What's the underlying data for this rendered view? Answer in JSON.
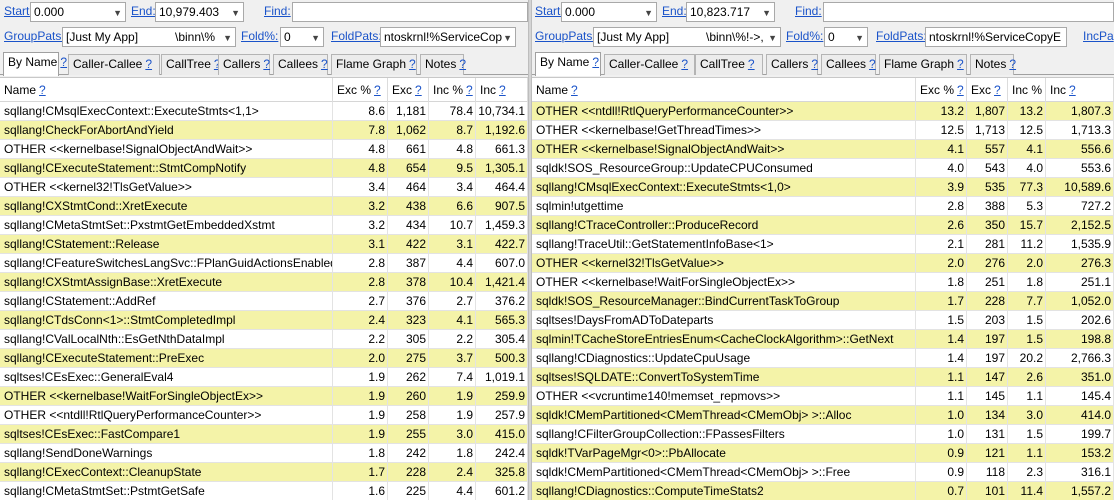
{
  "left": {
    "start_label": "Start:",
    "start_value": "0.000",
    "end_label": "End:",
    "end_value": "10,979.403",
    "find_label": "Find:",
    "find_value": "",
    "grouppats_label": "GroupPats:",
    "grouppats_value": "[Just My App]",
    "grouppats_extra": "\\binn\\%",
    "fold_label": "Fold%:",
    "fold_value": "0",
    "foldpats_label": "FoldPats:",
    "foldpats_value": "ntoskrnl!%ServiceCop",
    "tabs": [
      {
        "label": "By Name",
        "q": "?"
      },
      {
        "label": "Caller-Callee",
        "q": "?"
      },
      {
        "label": "CallTree",
        "q": "?"
      },
      {
        "label": "Callers",
        "q": "?"
      },
      {
        "label": "Callees",
        "q": "?"
      },
      {
        "label": "Flame Graph",
        "q": "?"
      },
      {
        "label": "Notes",
        "q": "?"
      }
    ],
    "columns": [
      {
        "label": "Name",
        "q": "?"
      },
      {
        "label": "Exc %",
        "q": "?"
      },
      {
        "label": "Exc",
        "q": "?"
      },
      {
        "label": "Inc %",
        "q": "?"
      },
      {
        "label": "Inc",
        "q": "?"
      }
    ],
    "rows": [
      {
        "name": "sqllang!CMsqlExecContext::ExecuteStmts<1,1>",
        "excp": "8.6",
        "exc": "1,181",
        "incp": "78.4",
        "inc": "10,734.1",
        "hl": false
      },
      {
        "name": "sqllang!CheckForAbortAndYield",
        "excp": "7.8",
        "exc": "1,062",
        "incp": "8.7",
        "inc": "1,192.6",
        "hl": true
      },
      {
        "name": "OTHER <<kernelbase!SignalObjectAndWait>>",
        "excp": "4.8",
        "exc": "661",
        "incp": "4.8",
        "inc": "661.3",
        "hl": false
      },
      {
        "name": "sqllang!CExecuteStatement::StmtCompNotify",
        "excp": "4.8",
        "exc": "654",
        "incp": "9.5",
        "inc": "1,305.1",
        "hl": true
      },
      {
        "name": "OTHER <<kernel32!TlsGetValue>>",
        "excp": "3.4",
        "exc": "464",
        "incp": "3.4",
        "inc": "464.4",
        "hl": false
      },
      {
        "name": "sqllang!CXStmtCond::XretExecute",
        "excp": "3.2",
        "exc": "438",
        "incp": "6.6",
        "inc": "907.5",
        "hl": true
      },
      {
        "name": "sqllang!CMetaStmtSet::PxstmtGetEmbeddedXstmt",
        "excp": "3.2",
        "exc": "434",
        "incp": "10.7",
        "inc": "1,459.3",
        "hl": false
      },
      {
        "name": "sqllang!CStatement::Release",
        "excp": "3.1",
        "exc": "422",
        "incp": "3.1",
        "inc": "422.7",
        "hl": true
      },
      {
        "name": "sqllang!CFeatureSwitchesLangSvc::FPlanGuidActionsEnabled",
        "excp": "2.8",
        "exc": "387",
        "incp": "4.4",
        "inc": "607.0",
        "hl": false
      },
      {
        "name": "sqllang!CXStmtAssignBase::XretExecute",
        "excp": "2.8",
        "exc": "378",
        "incp": "10.4",
        "inc": "1,421.4",
        "hl": true
      },
      {
        "name": "sqllang!CStatement::AddRef",
        "excp": "2.7",
        "exc": "376",
        "incp": "2.7",
        "inc": "376.2",
        "hl": false
      },
      {
        "name": "sqllang!CTdsConn<1>::StmtCompletedImpl",
        "excp": "2.4",
        "exc": "323",
        "incp": "4.1",
        "inc": "565.3",
        "hl": true
      },
      {
        "name": "sqllang!CValLocalNth::EsGetNthDataImpl",
        "excp": "2.2",
        "exc": "305",
        "incp": "2.2",
        "inc": "305.4",
        "hl": false
      },
      {
        "name": "sqllang!CExecuteStatement::PreExec",
        "excp": "2.0",
        "exc": "275",
        "incp": "3.7",
        "inc": "500.3",
        "hl": true
      },
      {
        "name": "sqltses!CEsExec::GeneralEval4",
        "excp": "1.9",
        "exc": "262",
        "incp": "7.4",
        "inc": "1,019.1",
        "hl": false
      },
      {
        "name": "OTHER <<kernelbase!WaitForSingleObjectEx>>",
        "excp": "1.9",
        "exc": "260",
        "incp": "1.9",
        "inc": "259.9",
        "hl": true
      },
      {
        "name": "OTHER <<ntdll!RtlQueryPerformanceCounter>>",
        "excp": "1.9",
        "exc": "258",
        "incp": "1.9",
        "inc": "257.9",
        "hl": false
      },
      {
        "name": "sqltses!CEsExec::FastCompare1",
        "excp": "1.9",
        "exc": "255",
        "incp": "3.0",
        "inc": "415.0",
        "hl": true
      },
      {
        "name": "sqllang!SendDoneWarnings",
        "excp": "1.8",
        "exc": "242",
        "incp": "1.8",
        "inc": "242.4",
        "hl": false
      },
      {
        "name": "sqllang!CExecContext::CleanupState",
        "excp": "1.7",
        "exc": "228",
        "incp": "2.4",
        "inc": "325.8",
        "hl": true
      },
      {
        "name": "sqllang!CMetaStmtSet::PstmtGetSafe",
        "excp": "1.6",
        "exc": "225",
        "incp": "4.4",
        "inc": "601.2",
        "hl": false
      }
    ]
  },
  "right": {
    "start_label": "Start:",
    "start_value": "0.000",
    "end_label": "End:",
    "end_value": "10,823.717",
    "find_label": "Find:",
    "find_value": "",
    "grouppats_label": "GroupPats:",
    "grouppats_value": "[Just My App]",
    "grouppats_extra": "\\binn\\%!->,",
    "fold_label": "Fold%:",
    "fold_value": "0",
    "foldpats_label": "FoldPats:",
    "foldpats_value": "ntoskrnl!%ServiceCopyE",
    "incpats_label": "IncPa",
    "tabs": [
      {
        "label": "By Name",
        "q": "?"
      },
      {
        "label": "Caller-Callee",
        "q": "?"
      },
      {
        "label": "CallTree",
        "q": "?"
      },
      {
        "label": "Callers",
        "q": "?"
      },
      {
        "label": "Callees",
        "q": "?"
      },
      {
        "label": "Flame Graph",
        "q": "?"
      },
      {
        "label": "Notes",
        "q": "?"
      }
    ],
    "columns": [
      {
        "label": "Name",
        "q": "?"
      },
      {
        "label": "Exc %",
        "q": "?"
      },
      {
        "label": "Exc",
        "q": "?"
      },
      {
        "label": "Inc %",
        "q": "?"
      },
      {
        "label": "Inc",
        "q": "?"
      }
    ],
    "rows": [
      {
        "name": "OTHER <<ntdll!RtlQueryPerformanceCounter>>",
        "excp": "13.2",
        "exc": "1,807",
        "incp": "13.2",
        "inc": "1,807.3",
        "hl": true
      },
      {
        "name": "OTHER <<kernelbase!GetThreadTimes>>",
        "excp": "12.5",
        "exc": "1,713",
        "incp": "12.5",
        "inc": "1,713.3",
        "hl": false
      },
      {
        "name": "OTHER <<kernelbase!SignalObjectAndWait>>",
        "excp": "4.1",
        "exc": "557",
        "incp": "4.1",
        "inc": "556.6",
        "hl": true
      },
      {
        "name": "sqldk!SOS_ResourceGroup::UpdateCPUConsumed",
        "excp": "4.0",
        "exc": "543",
        "incp": "4.0",
        "inc": "553.6",
        "hl": false
      },
      {
        "name": "sqllang!CMsqlExecContext::ExecuteStmts<1,0>",
        "excp": "3.9",
        "exc": "535",
        "incp": "77.3",
        "inc": "10,589.6",
        "hl": true
      },
      {
        "name": "sqlmin!utgettime",
        "excp": "2.8",
        "exc": "388",
        "incp": "5.3",
        "inc": "727.2",
        "hl": false
      },
      {
        "name": "sqllang!CTraceController::ProduceRecord",
        "excp": "2.6",
        "exc": "350",
        "incp": "15.7",
        "inc": "2,152.5",
        "hl": true
      },
      {
        "name": "sqllang!TraceUtil::GetStatementInfoBase<1>",
        "excp": "2.1",
        "exc": "281",
        "incp": "11.2",
        "inc": "1,535.9",
        "hl": false
      },
      {
        "name": "OTHER <<kernel32!TlsGetValue>>",
        "excp": "2.0",
        "exc": "276",
        "incp": "2.0",
        "inc": "276.3",
        "hl": true
      },
      {
        "name": "OTHER <<kernelbase!WaitForSingleObjectEx>>",
        "excp": "1.8",
        "exc": "251",
        "incp": "1.8",
        "inc": "251.1",
        "hl": false
      },
      {
        "name": "sqldk!SOS_ResourceManager::BindCurrentTaskToGroup",
        "excp": "1.7",
        "exc": "228",
        "incp": "7.7",
        "inc": "1,052.0",
        "hl": true
      },
      {
        "name": "sqltses!DaysFromADToDateparts",
        "excp": "1.5",
        "exc": "203",
        "incp": "1.5",
        "inc": "202.6",
        "hl": false
      },
      {
        "name": "sqlmin!TCacheStoreEntriesEnum<CacheClockAlgorithm>::GetNext",
        "excp": "1.4",
        "exc": "197",
        "incp": "1.5",
        "inc": "198.8",
        "hl": true
      },
      {
        "name": "sqllang!CDiagnostics::UpdateCpuUsage",
        "excp": "1.4",
        "exc": "197",
        "incp": "20.2",
        "inc": "2,766.3",
        "hl": false
      },
      {
        "name": "sqltses!SQLDATE::ConvertToSystemTime",
        "excp": "1.1",
        "exc": "147",
        "incp": "2.6",
        "inc": "351.0",
        "hl": true
      },
      {
        "name": "OTHER <<vcruntime140!memset_repmovs>>",
        "excp": "1.1",
        "exc": "145",
        "incp": "1.1",
        "inc": "145.4",
        "hl": false
      },
      {
        "name": "sqldk!CMemPartitioned<CMemThread<CMemObj> >::Alloc",
        "excp": "1.0",
        "exc": "134",
        "incp": "3.0",
        "inc": "414.0",
        "hl": true
      },
      {
        "name": "sqllang!CFilterGroupCollection::FPassesFilters",
        "excp": "1.0",
        "exc": "131",
        "incp": "1.5",
        "inc": "199.7",
        "hl": false
      },
      {
        "name": "sqldk!TVarPageMgr<0>::PbAllocate",
        "excp": "0.9",
        "exc": "121",
        "incp": "1.1",
        "inc": "153.2",
        "hl": true
      },
      {
        "name": "sqldk!CMemPartitioned<CMemThread<CMemObj> >::Free",
        "excp": "0.9",
        "exc": "118",
        "incp": "2.3",
        "inc": "316.1",
        "hl": false
      },
      {
        "name": "sqllang!CDiagnostics::ComputeTimeStats2",
        "excp": "0.7",
        "exc": "101",
        "incp": "11.4",
        "inc": "1,557.2",
        "hl": true
      }
    ]
  },
  "colors": {
    "highlight": "#f4f3a8",
    "link": "#1a53c9"
  }
}
